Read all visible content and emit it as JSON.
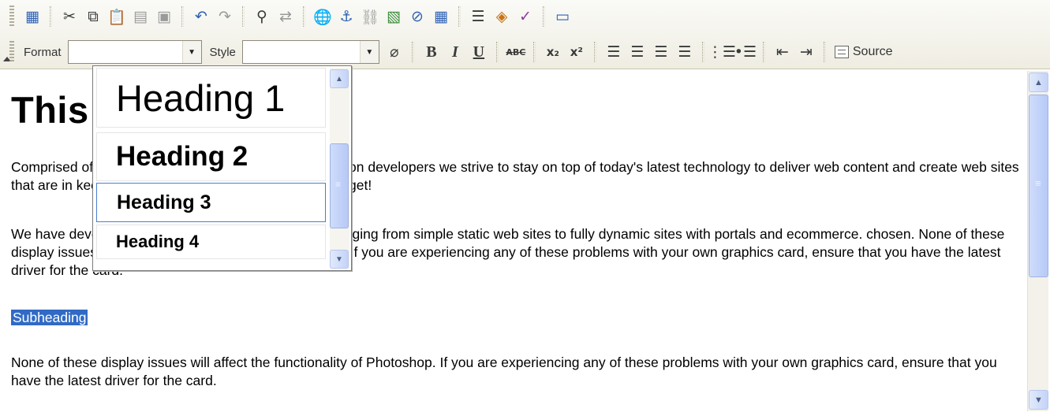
{
  "toolbar": {
    "row1_icons": [
      "select-all-icon",
      "cut-icon",
      "copy-icon",
      "paste-icon",
      "paste-text-icon",
      "paste-word-icon",
      "undo-icon",
      "redo-icon",
      "find-icon",
      "replace-icon",
      "link-icon",
      "anchor-icon",
      "unlink-icon",
      "image-icon",
      "flash-icon",
      "table-icon",
      "horizontal-rule-icon",
      "smiley-icon",
      "spellcheck-icon",
      "page-break-icon"
    ],
    "format_label": "Format",
    "format_value": "",
    "style_label": "Style",
    "style_value": "",
    "bold_label": "B",
    "italic_label": "I",
    "underline_label": "U",
    "strike_label": "ABC",
    "subscript_label": "x₂",
    "superscript_label": "x²",
    "source_label": "Source"
  },
  "dropdown": {
    "items": [
      "Heading 1",
      "Heading 2",
      "Heading 3",
      "Heading 4"
    ],
    "highlighted": "Heading 3"
  },
  "content": {
    "heading": "This is the Editor",
    "para1": "Comprised of a team of graphic designers and application developers we strive to stay on top of today's latest technology to deliver web content and create web sites that are in keeping with your philosophies and your budget!",
    "para2": "We have developed web sites for a variety of clients ranging from simple static web sites to fully dynamic sites with portals and ecommerce. chosen. None of these display issues will affect the functionality of Photoshop. If you are experiencing any of these problems with your own graphics card, ensure that you have the latest driver for the card.",
    "selected": "Subheading",
    "para3": "None of these display issues will affect the functionality of Photoshop. If you are experiencing any of these problems with your own graphics card, ensure that you have the latest driver for the card."
  }
}
